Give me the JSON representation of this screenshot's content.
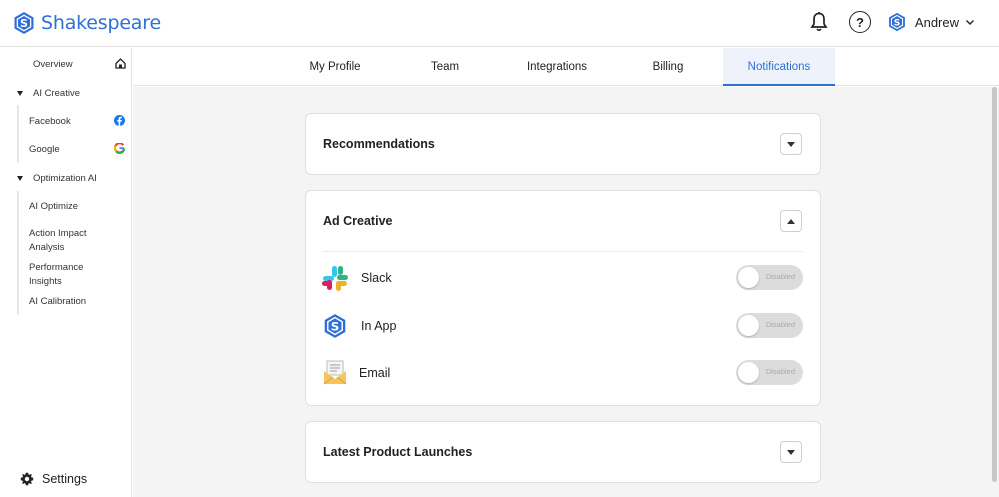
{
  "app": {
    "name": "Shakespeare"
  },
  "header": {
    "user_name": "Andrew",
    "help_symbol": "?"
  },
  "sidebar": {
    "overview": "Overview",
    "ai_creative": {
      "label": "AI Creative",
      "items": [
        "Facebook",
        "Google"
      ]
    },
    "optimization_ai": {
      "label": "Optimization AI",
      "items": [
        "AI Optimize",
        "Action Impact Analysis",
        "Performance Insights",
        "AI Calibration"
      ]
    },
    "settings": "Settings"
  },
  "tabs": [
    "My Profile",
    "Team",
    "Integrations",
    "Billing",
    "Notifications"
  ],
  "active_tab": "Notifications",
  "sections": {
    "recommendations": {
      "title": "Recommendations",
      "expanded": false
    },
    "ad_creative": {
      "title": "Ad Creative",
      "expanded": true,
      "channels": [
        {
          "label": "Slack",
          "status": "Disabled",
          "icon": "slack-icon"
        },
        {
          "label": "In App",
          "status": "Disabled",
          "icon": "shakespeare-app-icon"
        },
        {
          "label": "Email",
          "status": "Disabled",
          "icon": "email-envelope-icon"
        }
      ]
    },
    "latest_product_launches": {
      "title": "Latest Product Launches",
      "expanded": false
    }
  },
  "colors": {
    "accent": "#2f6fd6",
    "active_tab_bg": "#eef3fb",
    "switch_off": "#dcdcdc"
  }
}
